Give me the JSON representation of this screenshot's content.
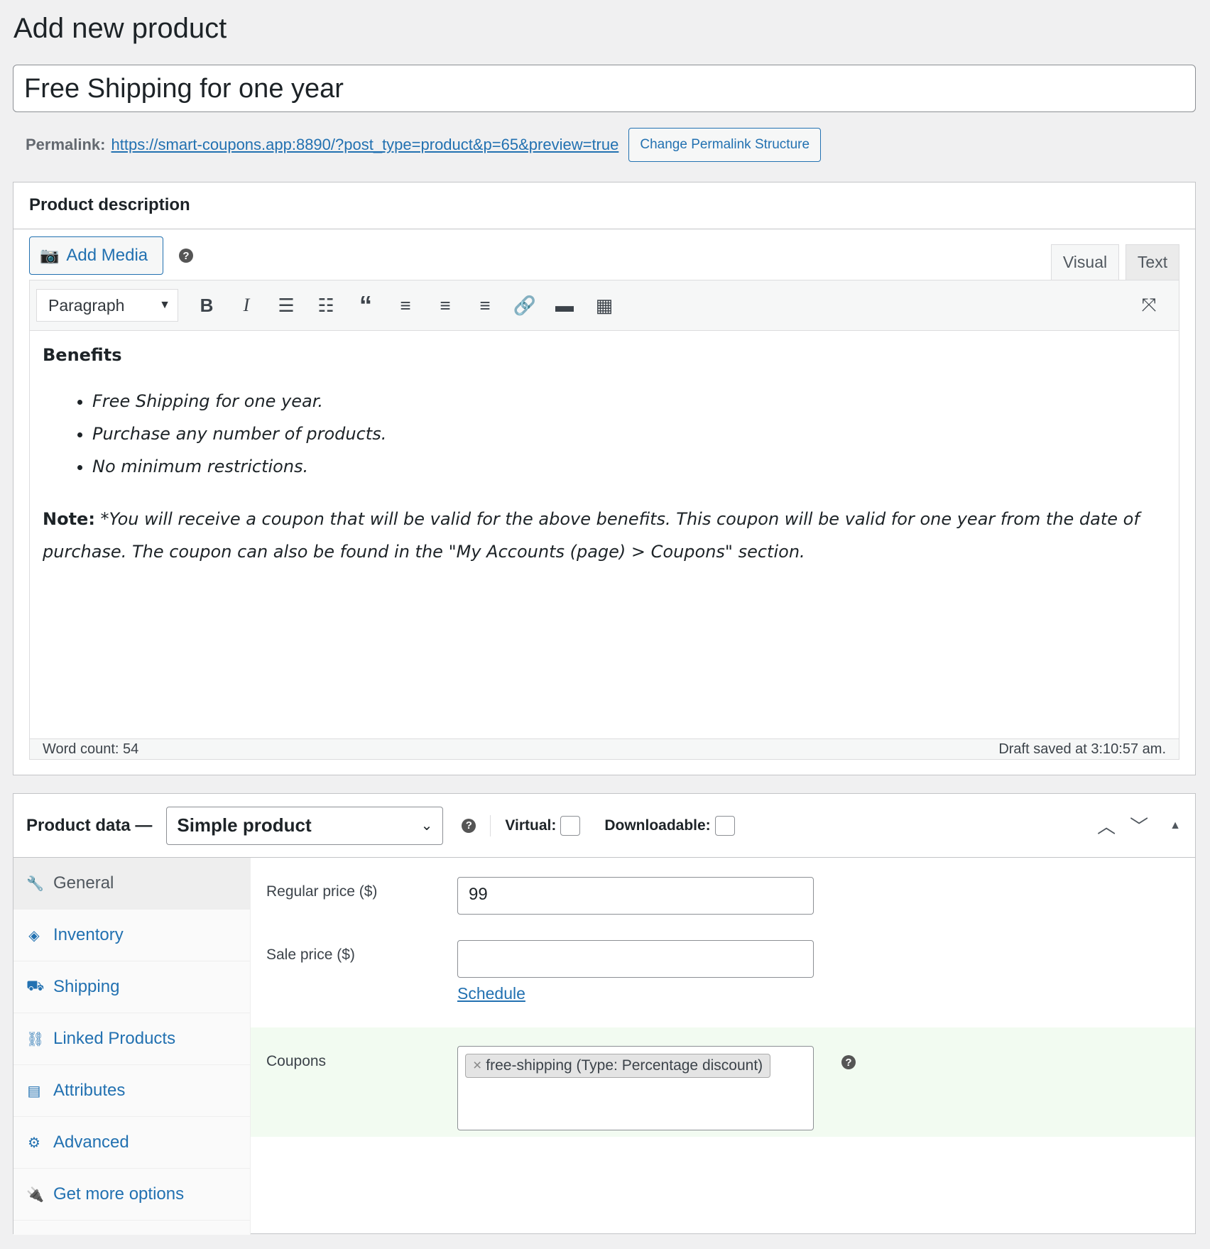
{
  "page": {
    "title": "Add new product"
  },
  "post_title": "Free Shipping for one year",
  "permalink": {
    "label": "Permalink:",
    "url": "https://smart-coupons.app:8890/?post_type=product&p=65&preview=true",
    "button": "Change Permalink Structure"
  },
  "description": {
    "heading": "Product description",
    "add_media": "Add Media",
    "tabs": {
      "visual": "Visual",
      "text": "Text"
    },
    "format": "Paragraph",
    "content": {
      "heading": "Benefits",
      "bullets": [
        "Free Shipping for one year.",
        "Purchase any number of products.",
        "No minimum restrictions."
      ],
      "note_label": "Note:",
      "note_text": " *You will receive a coupon that will be valid for the above benefits. This coupon will be valid for one year from the date of purchase. The coupon can also be found in the \"My Accounts (page) > Coupons\" section."
    },
    "word_count": "Word count: 54",
    "draft_saved": "Draft saved at 3:10:57 am."
  },
  "product_data": {
    "label": "Product data —",
    "type": "Simple product",
    "virtual": "Virtual:",
    "downloadable": "Downloadable:",
    "tabs": [
      {
        "label": "General",
        "icon": "wrench-icon"
      },
      {
        "label": "Inventory",
        "icon": "tag-icon"
      },
      {
        "label": "Shipping",
        "icon": "truck-icon"
      },
      {
        "label": "Linked Products",
        "icon": "link-icon"
      },
      {
        "label": "Attributes",
        "icon": "list-icon"
      },
      {
        "label": "Advanced",
        "icon": "gear-icon"
      },
      {
        "label": "Get more options",
        "icon": "plugin-icon"
      }
    ],
    "regular_price_label": "Regular price ($)",
    "regular_price": "99",
    "sale_price_label": "Sale price ($)",
    "sale_price": "",
    "schedule": "Schedule",
    "coupons_label": "Coupons",
    "coupon_tag": "free-shipping (Type: Percentage discount)"
  },
  "colors": {
    "accent": "#2271b1",
    "coupon_row_bg": "#f2fbf1"
  }
}
